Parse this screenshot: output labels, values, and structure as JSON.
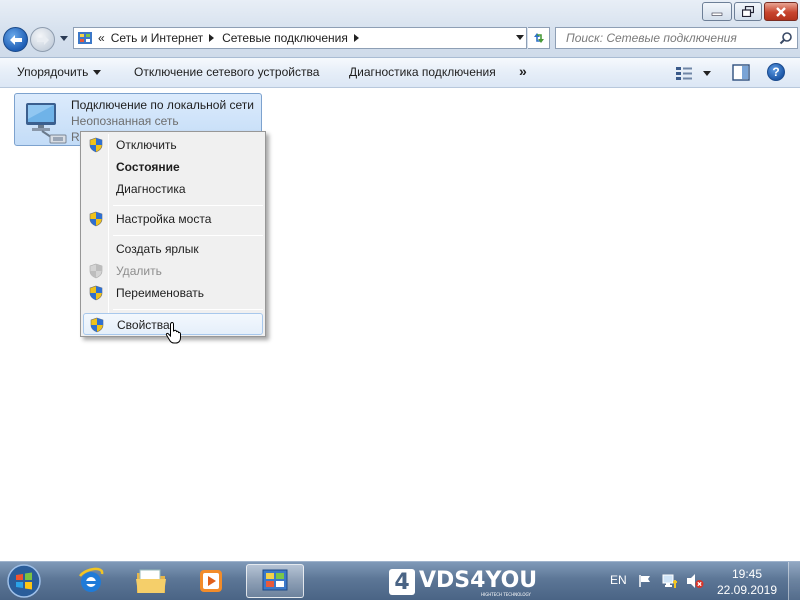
{
  "window": {
    "colors": {
      "titlebar": "#d6e1ee",
      "close": "#c8452e",
      "accent": "#1f5fb6"
    },
    "buttons": [
      "minimize-icon",
      "maximize-icon",
      "close-icon"
    ]
  },
  "address": {
    "chevron": "«",
    "breadcrumbs": [
      "Сеть и Интернет",
      "Сетевые подключения"
    ],
    "icons": [
      "control-panel-icon",
      "refresh-icon"
    ]
  },
  "search": {
    "placeholder": "Поиск: Сетевые подключения",
    "icon": "search-icon"
  },
  "toolbar": {
    "organize": "Упорядочить",
    "disable_device": "Отключение сетевого устройства",
    "diagnose": "Диагностика подключения",
    "more": "»",
    "help": "?"
  },
  "adapter": {
    "name": "Подключение по локальной сети",
    "status": "Неопознанная сеть",
    "device_fragment": "R"
  },
  "context_menu": {
    "items": [
      {
        "label": "Отключить",
        "shield": true
      },
      {
        "label": "Состояние",
        "bold": true
      },
      {
        "label": "Диагностика"
      },
      {
        "label": "Настройка моста",
        "shield": true
      },
      {
        "label": "Создать ярлык"
      },
      {
        "label": "Удалить",
        "shield": true,
        "disabled": true
      },
      {
        "label": "Переименовать",
        "shield": true
      },
      {
        "label": "Свойства",
        "shield": true,
        "hovered": true
      }
    ]
  },
  "taskbar": {
    "apps": [
      "windows-start-icon",
      "internet-explorer-icon",
      "file-explorer-icon",
      "media-player-icon",
      "network-connections-icon"
    ],
    "logo_number": "4",
    "logo_text": "VDS4YOU",
    "logo_tagline": "HIGHTECH TECHNOLOGY",
    "language": "EN",
    "time": "19:45",
    "date": "22.09.2019"
  }
}
